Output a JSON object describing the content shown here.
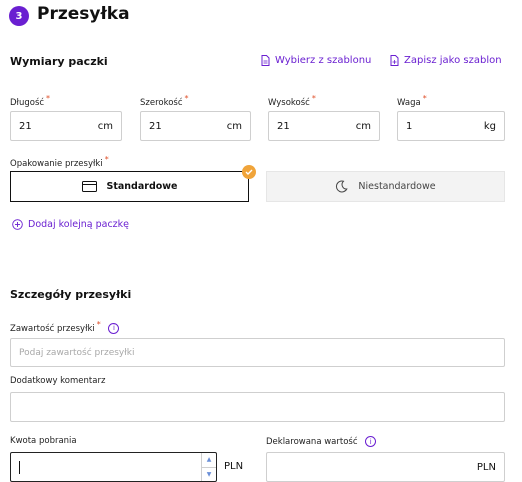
{
  "step": {
    "number": "3",
    "title": "Przesyłka"
  },
  "dimensions": {
    "title": "Wymiary paczki",
    "template_select_label": "Wybierz z szablonu",
    "template_save_label": "Zapisz jako szablon",
    "fields": [
      {
        "label": "Długość",
        "value": "21",
        "unit": "cm"
      },
      {
        "label": "Szerokość",
        "value": "21",
        "unit": "cm"
      },
      {
        "label": "Wysokość",
        "value": "21",
        "unit": "cm"
      },
      {
        "label": "Waga",
        "value": "1",
        "unit": "kg"
      }
    ],
    "required_mark": "*"
  },
  "packaging": {
    "label": "Opakowanie przesyłki",
    "options": [
      {
        "label": "Standardowe",
        "selected": true
      },
      {
        "label": "Niestandardowe",
        "selected": false
      }
    ]
  },
  "add_package_label": "Dodaj kolejną paczkę",
  "details": {
    "title": "Szczegóły przesyłki",
    "contents": {
      "label": "Zawartość przesyłki",
      "placeholder": "Podaj zawartość przesyłki"
    },
    "comment": {
      "label": "Dodatkowy komentarz",
      "value": ""
    },
    "cod": {
      "label": "Kwota pobrania",
      "value": "",
      "unit": "PLN"
    },
    "declared": {
      "label": "Deklarowana wartość",
      "value": "",
      "unit": "PLN"
    }
  },
  "colors": {
    "accent": "#6a1fd1",
    "check": "#f0a43a",
    "required": "#e0502a"
  }
}
